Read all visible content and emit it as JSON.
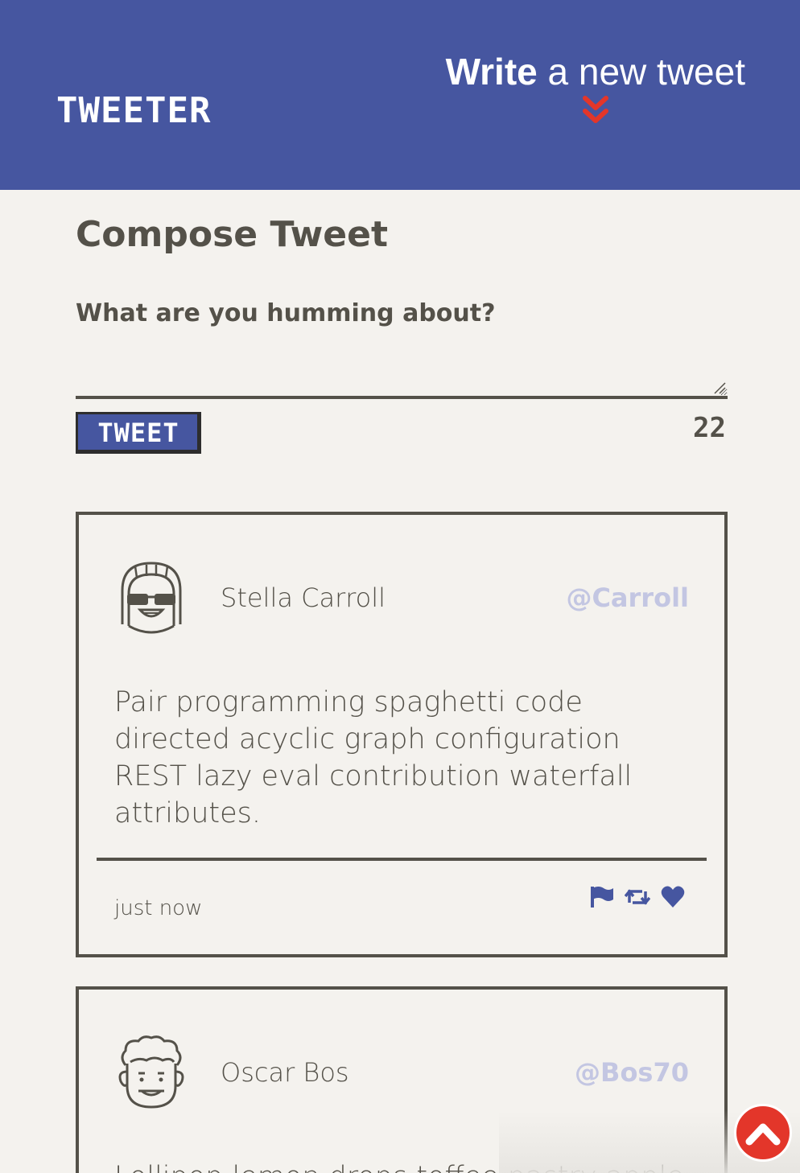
{
  "nav": {
    "brand": "TWEETER",
    "compose_toggle": {
      "bold": "Write",
      "rest": " a new tweet",
      "icon": "chevron-double-down-icon",
      "icon_color": "#e3362a"
    },
    "background_color": "#4656a0"
  },
  "compose": {
    "title": "Compose Tweet",
    "label": "What are you humming about?",
    "input_value": "",
    "button_label": "TWEET",
    "counter": "22"
  },
  "tweets": [
    {
      "name": "Stella Carroll",
      "handle": "@Carroll",
      "avatar": "girl-glasses-avatar-icon",
      "content": "Pair programming spaghetti code directed acyclic graph configuration REST lazy eval contribution waterfall attributes.",
      "timestamp": "just now",
      "actions": [
        "flag-icon",
        "retweet-icon",
        "heart-icon"
      ]
    },
    {
      "name": "Oscar Bos",
      "handle": "@Bos70",
      "avatar": "curly-hair-avatar-icon",
      "content": "Lollipop lemon drops toffee pastry apple pie"
    }
  ],
  "scroll_top": {
    "icon": "chevron-up-icon",
    "color": "#e3362a"
  }
}
